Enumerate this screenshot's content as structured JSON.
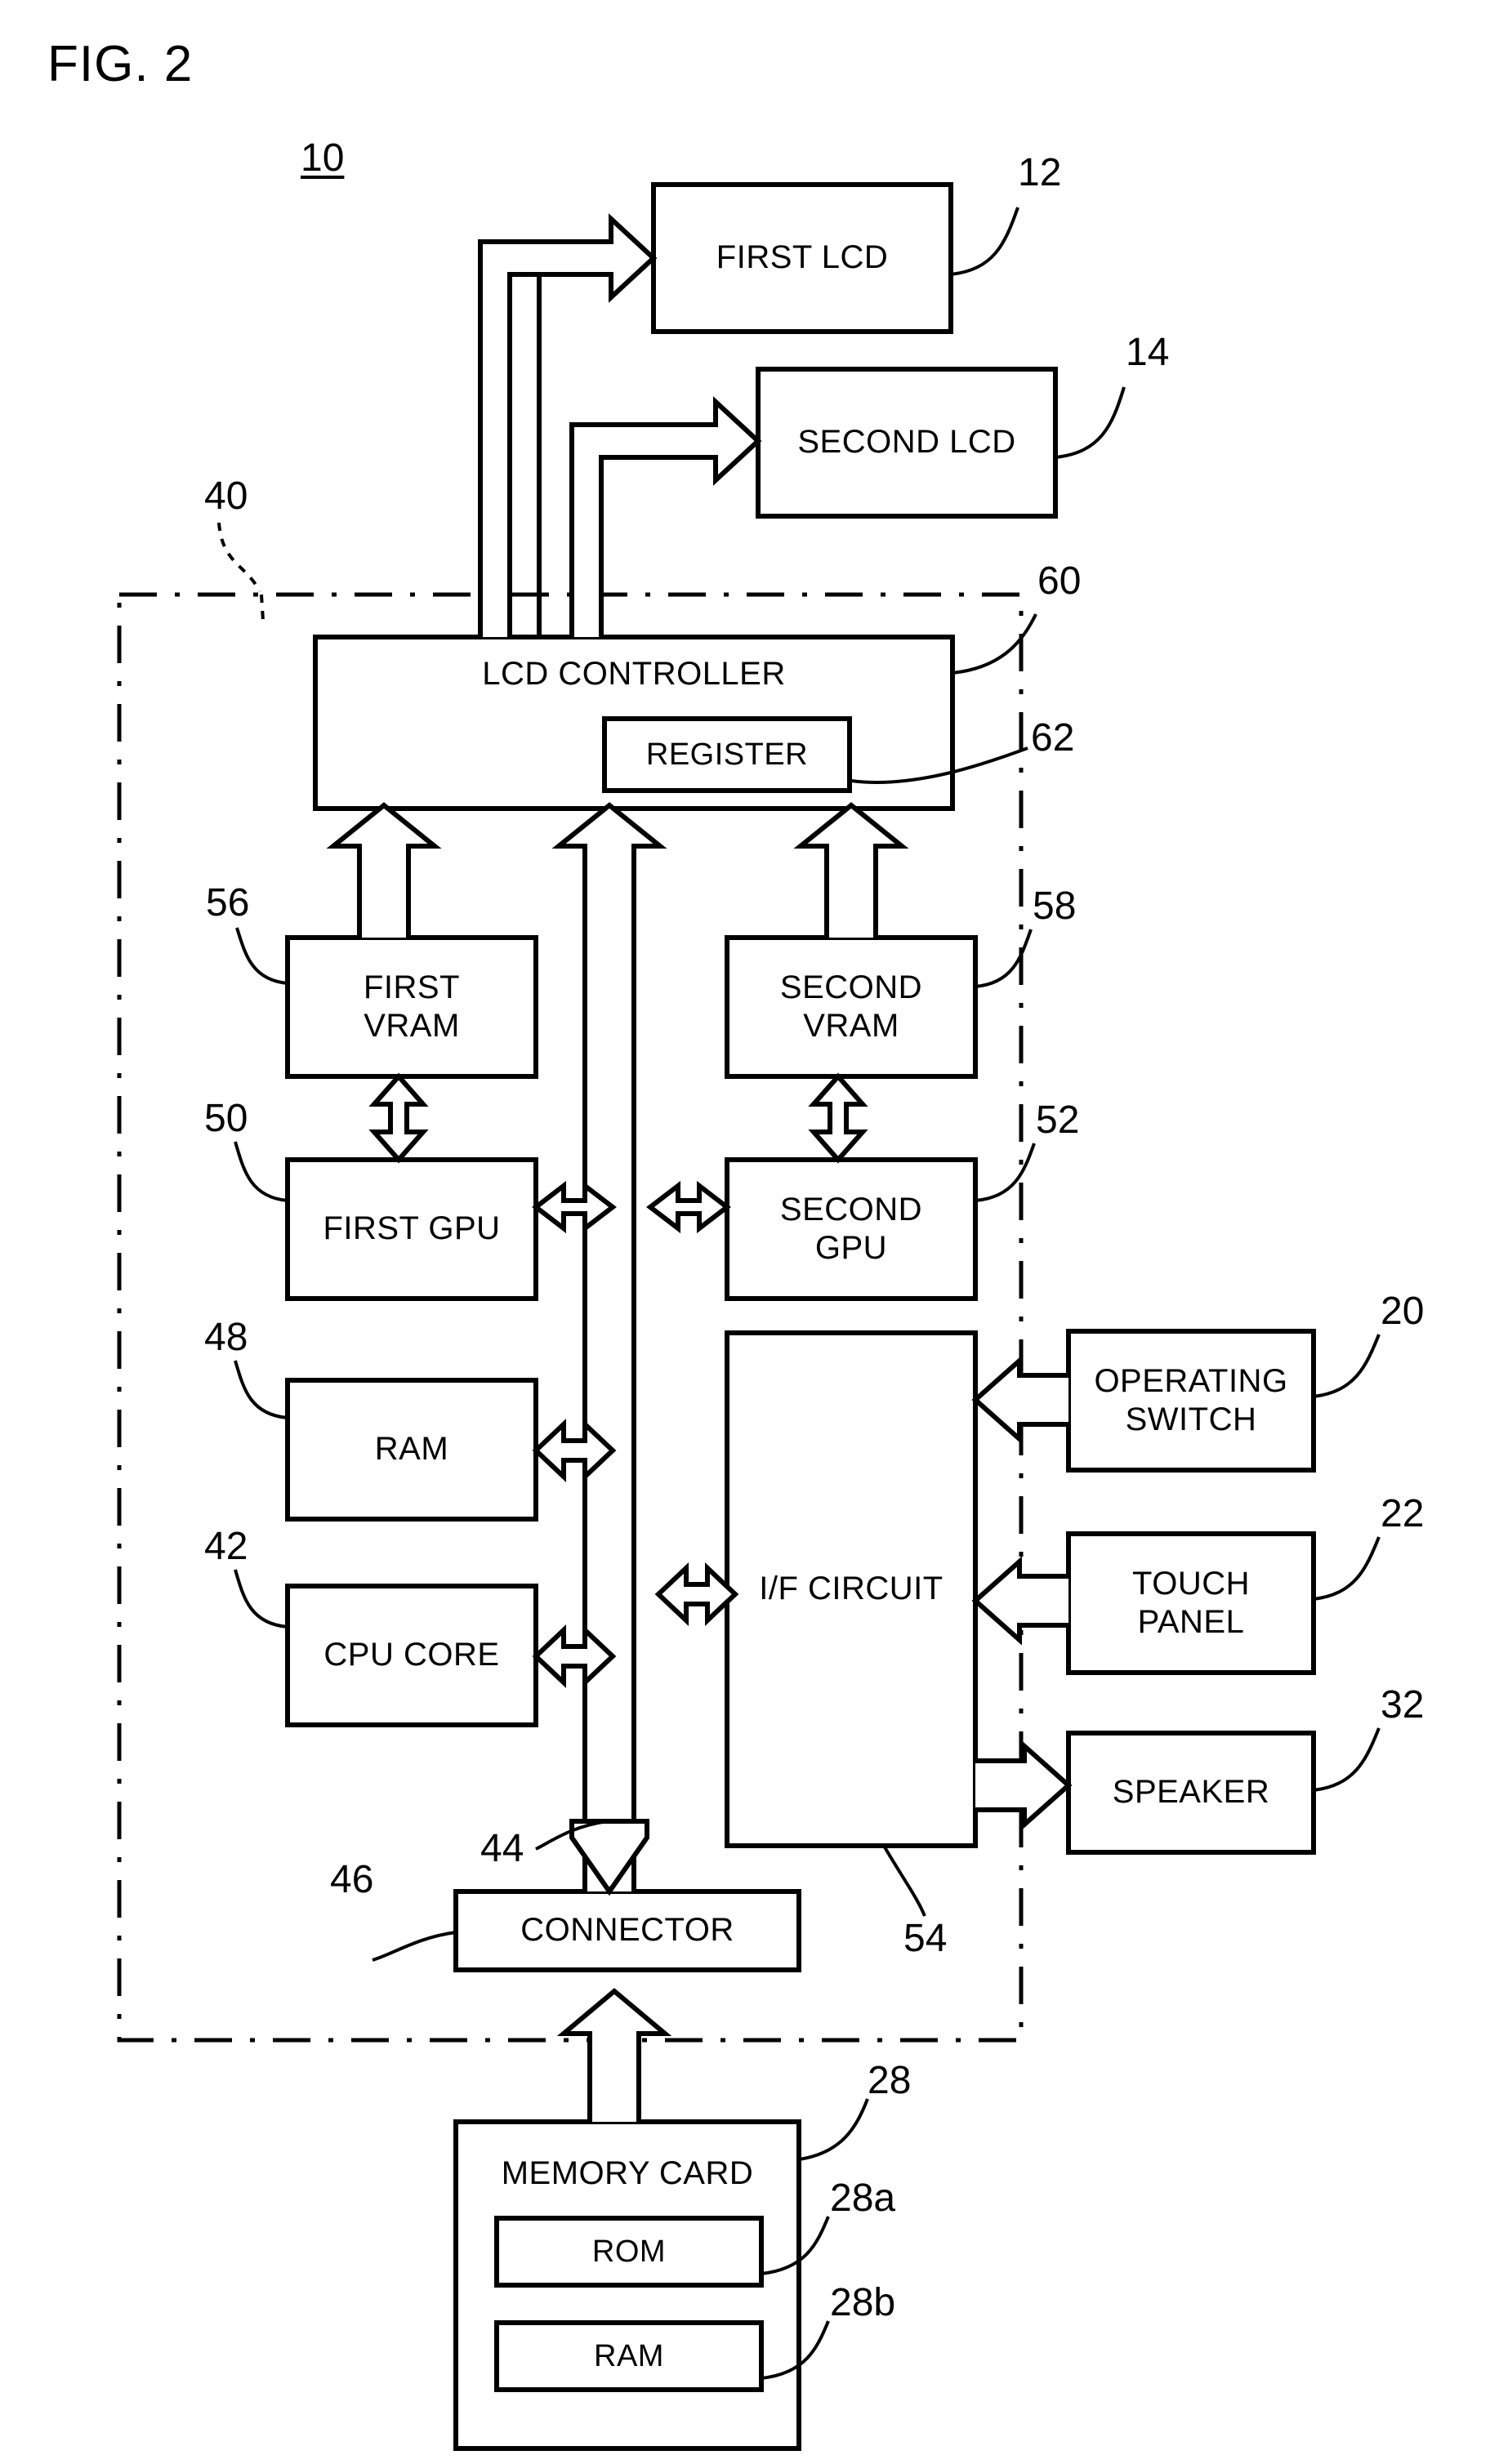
{
  "figure": {
    "title": "FIG. 2",
    "system_ref": "10"
  },
  "boxes": {
    "first_lcd": {
      "label": "FIRST LCD",
      "ref": "12"
    },
    "second_lcd": {
      "label": "SECOND LCD",
      "ref": "14"
    },
    "lcd_controller": {
      "label": "LCD CONTROLLER",
      "ref": "60"
    },
    "register": {
      "label": "REGISTER",
      "ref": "62"
    },
    "first_vram": {
      "label": "FIRST\nVRAM",
      "ref": "56"
    },
    "second_vram": {
      "label": "SECOND\nVRAM",
      "ref": "58"
    },
    "first_gpu": {
      "label": "FIRST GPU",
      "ref": "50"
    },
    "second_gpu": {
      "label": "SECOND\nGPU",
      "ref": "52"
    },
    "ram": {
      "label": "RAM",
      "ref": "48"
    },
    "cpu_core": {
      "label": "CPU CORE",
      "ref": "42"
    },
    "if_circuit": {
      "label": "I/F CIRCUIT",
      "ref": "54"
    },
    "operating_switch": {
      "label": "OPERATING\nSWITCH",
      "ref": "20"
    },
    "touch_panel": {
      "label": "TOUCH\nPANEL",
      "ref": "22"
    },
    "speaker": {
      "label": "SPEAKER",
      "ref": "32"
    },
    "connector": {
      "label": "CONNECTOR",
      "ref": "46"
    },
    "memory_card": {
      "label": "MEMORY CARD",
      "ref": "28"
    },
    "memory_card_rom": {
      "label": "ROM",
      "ref": "28a"
    },
    "memory_card_ram": {
      "label": "RAM",
      "ref": "28b"
    }
  },
  "enclosure": {
    "electronic_circuit_board_ref": "40",
    "bus_ref": "44"
  },
  "colors": {
    "stroke": "#000000",
    "background": "#ffffff"
  }
}
